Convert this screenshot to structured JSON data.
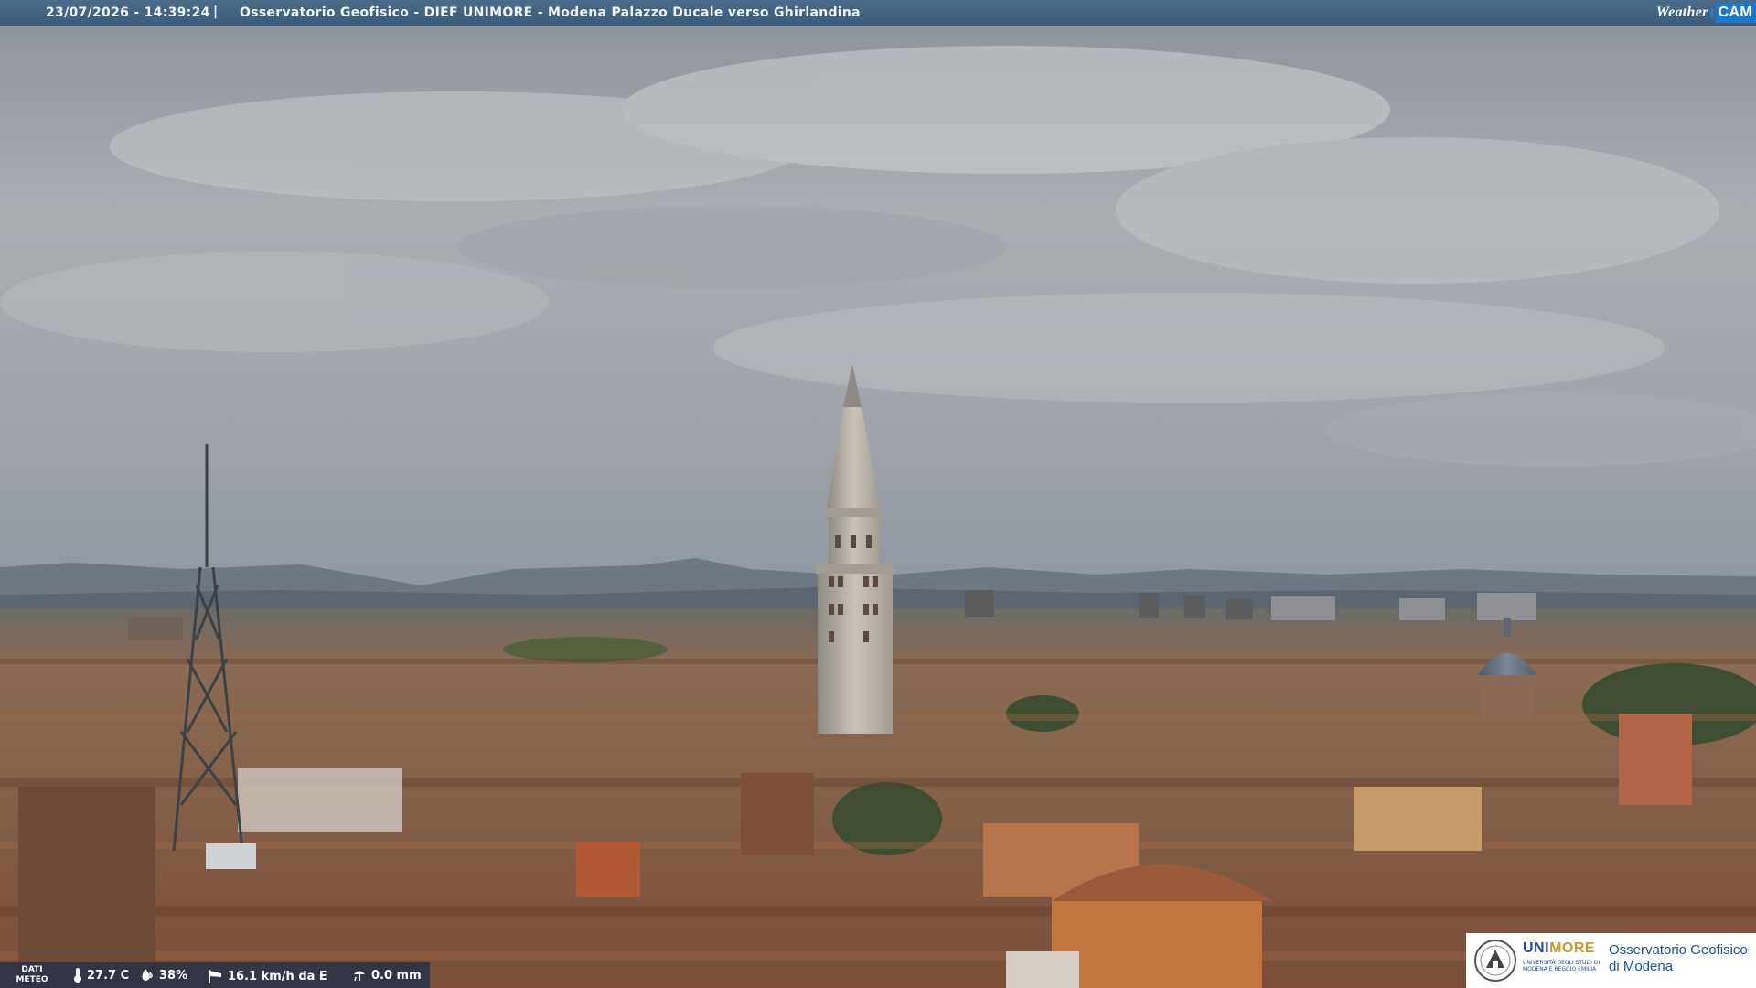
{
  "overlay": {
    "timestamp": "23/07/2026 - 14:39:24",
    "separator": "|",
    "camera_title": "Osservatorio Geofisico - DIEF UNIMORE - Modena Palazzo Ducale verso Ghirlandina",
    "logo": {
      "weather": "Weather",
      "cam": "CAM"
    }
  },
  "meteo": {
    "label_line1": "DATI",
    "label_line2": "METEO",
    "temperature": "27.7 C",
    "humidity": "38%",
    "wind": "16.1 km/h da E",
    "rain": "0.0 mm",
    "icons": [
      "thermometer-icon",
      "humidity-drop-icon",
      "wind-sock-icon",
      "rain-gauge-icon"
    ]
  },
  "branding": {
    "brand_uni": "UNI",
    "brand_more": "MORE",
    "uni_sub": "UNIVERSITÀ DEGLI STUDI DI MODENA E REGGIO EMILIA",
    "obs_line1": "Osservatorio Geofisico",
    "obs_line2": "di Modena"
  },
  "colors": {
    "bar": "#3d5c7a",
    "roof": "#8a5a40",
    "sky": "#9aa0a7",
    "brand_blue": "#1f4e96",
    "brand_gold": "#c79a2e"
  }
}
